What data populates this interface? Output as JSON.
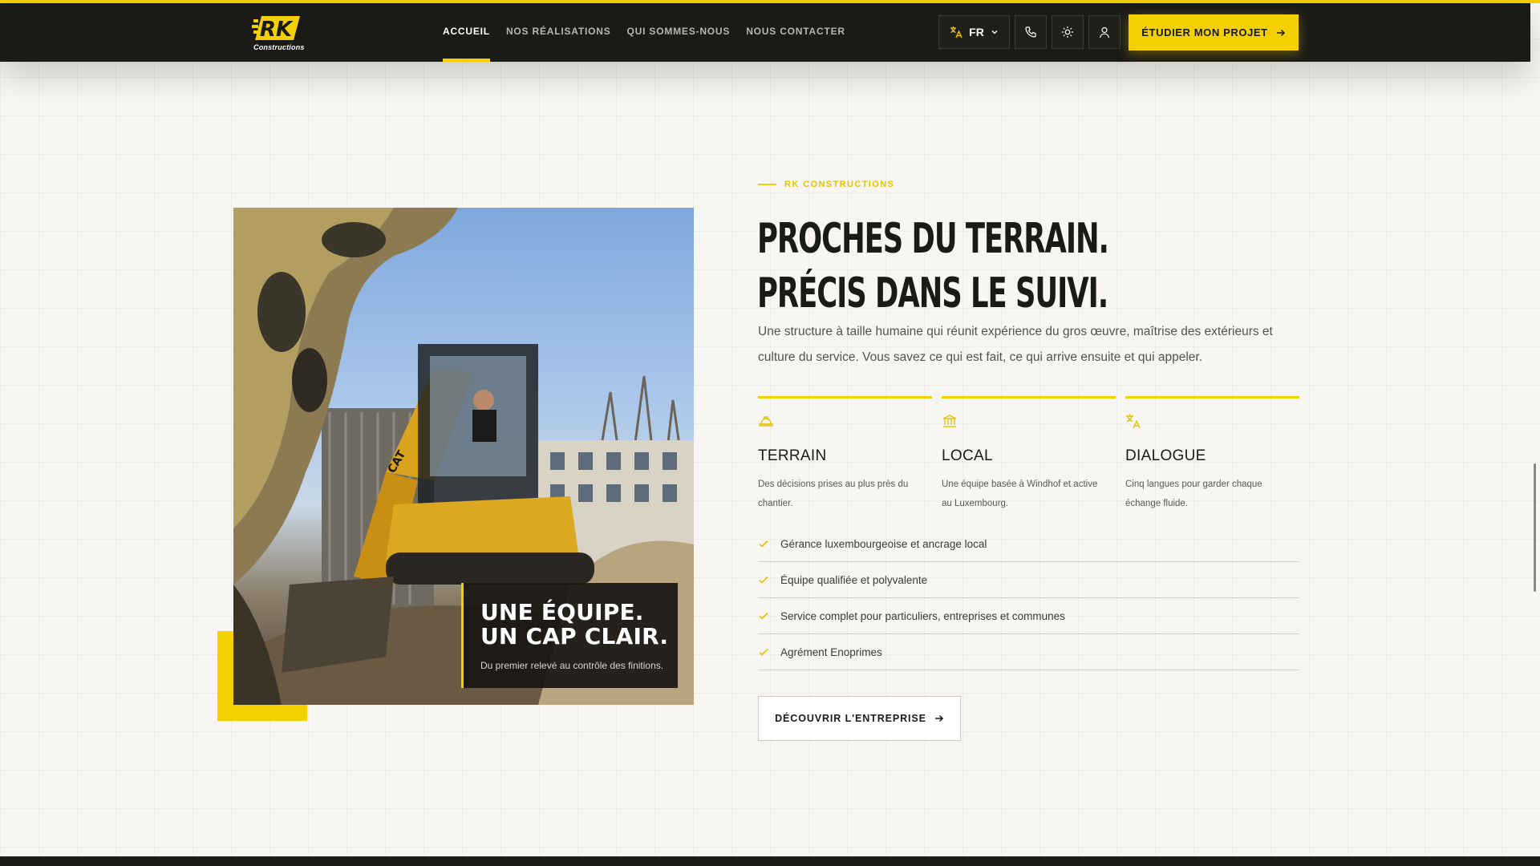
{
  "brand": {
    "logo_text": "RK",
    "logo_sub": "Constructions",
    "accent_color": "#f5d000",
    "dark_color": "#1a1a17"
  },
  "nav": {
    "items": [
      {
        "label": "ACCUEIL",
        "active": true
      },
      {
        "label": "NOS RÉALISATIONS",
        "active": false
      },
      {
        "label": "QUI SOMMES-NOUS",
        "active": false
      },
      {
        "label": "NOUS CONTACTER",
        "active": false
      }
    ]
  },
  "header": {
    "language": "FR",
    "icons": [
      "translate-icon",
      "chevron-down-icon",
      "phone-icon",
      "sun-icon",
      "user-icon",
      "arrow-right-icon"
    ],
    "cta_label": "ÉTUDIER MON PROJET"
  },
  "photo_card": {
    "title_line1": "UNE ÉQUIPE.",
    "title_line2": "UN CAP CLAIR.",
    "subtitle": "Du premier relevé au contrôle des finitions.",
    "excavator_brand": "CAT"
  },
  "section": {
    "eyebrow": "RK CONSTRUCTIONS",
    "headline_line1": "PROCHES DU TERRAIN.",
    "headline_line2": "PRÉCIS DANS LE SUIVI.",
    "intro": "Une structure à taille humaine qui réunit expérience du gros œuvre, maîtrise des extérieurs et culture du service. Vous savez ce qui est fait, ce qui arrive ensuite et qui appeler.",
    "features": [
      {
        "icon": "hard-hat-icon",
        "title": "TERRAIN",
        "text": "Des décisions prises au plus près du chantier."
      },
      {
        "icon": "landmark-icon",
        "title": "LOCAL",
        "text": "Une équipe basée à Windhof et active au Luxembourg."
      },
      {
        "icon": "translate-icon",
        "title": "DIALOGUE",
        "text": "Cinq langues pour garder chaque échange fluide."
      }
    ],
    "checklist": [
      "Gérance luxembourgeoise et ancrage local",
      "Équipe qualifiée et polyvalente",
      "Service complet pour particuliers, entreprises et communes",
      "Agrément Enoprimes"
    ],
    "button_label": "DÉCOUVRIR L'ENTREPRISE"
  }
}
